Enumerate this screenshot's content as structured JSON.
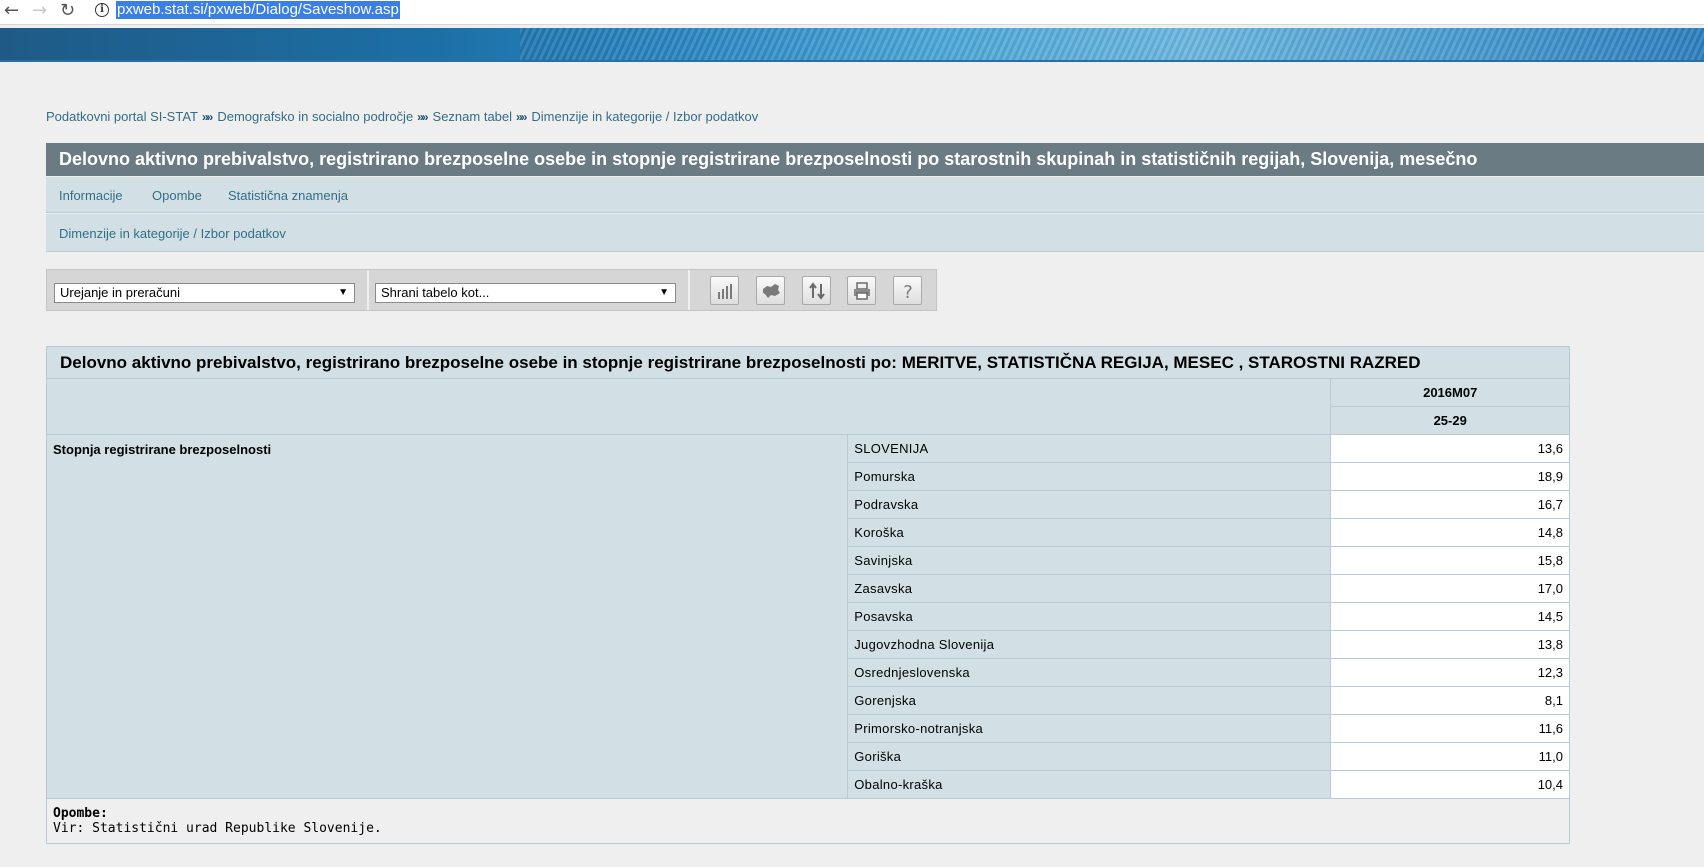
{
  "browser": {
    "back_icon": "←",
    "forward_icon": "→",
    "reload_icon": "↻",
    "url": "pxweb.stat.si/pxweb/Dialog/Saveshow.asp"
  },
  "breadcrumb": [
    "Podatkovni portal SI-STAT",
    "Demografsko in socialno področje",
    "Seznam tabel",
    "Dimenzije in kategorije / Izbor podatkov"
  ],
  "breadcrumb_separator": "»»",
  "page_title": "Delovno aktivno prebivalstvo, registrirano brezposelne osebe in stopnje registrirane brezposelnosti po starostnih skupinah in statističnih regijah, Slovenija, mesečno",
  "tabs": [
    "Informacije",
    "Opombe",
    "Statistična znamenja"
  ],
  "subnav": "Dimenzije in kategorije / Izbor podatkov",
  "toolbar": {
    "select_edit": "Urejanje in preračuni",
    "select_save": "Shrani tabelo kot...",
    "buttons": [
      "chart-icon",
      "map-icon",
      "pivot-icon",
      "print-icon",
      "help-icon"
    ]
  },
  "table": {
    "caption": "Delovno aktivno prebivalstvo, registrirano brezposelne osebe in stopnje registrirane brezposelnosti po: MERITVE, STATISTIČNA REGIJA, MESEC , STAROSTNI RAZRED",
    "month": "2016M07",
    "age_group": "25-29",
    "measure": "Stopnja registrirane brezposelnosti",
    "rows": [
      {
        "region": "SLOVENIJA",
        "value": "13,6"
      },
      {
        "region": "Pomurska",
        "value": "18,9"
      },
      {
        "region": "Podravska",
        "value": "16,7"
      },
      {
        "region": "Koroška",
        "value": "14,8"
      },
      {
        "region": "Savinjska",
        "value": "15,8"
      },
      {
        "region": "Zasavska",
        "value": "17,0"
      },
      {
        "region": "Posavska",
        "value": "14,5"
      },
      {
        "region": "Jugovzhodna Slovenija",
        "value": "13,8"
      },
      {
        "region": "Osrednjeslovenska",
        "value": "12,3"
      },
      {
        "region": "Gorenjska",
        "value": "8,1"
      },
      {
        "region": "Primorsko-notranjska",
        "value": "11,6"
      },
      {
        "region": "Goriška",
        "value": "11,0"
      },
      {
        "region": "Obalno-kraška",
        "value": "10,4"
      }
    ]
  },
  "notes": {
    "heading": "Opombe:",
    "source": "Vir: Statistični urad Republike Slovenije."
  }
}
